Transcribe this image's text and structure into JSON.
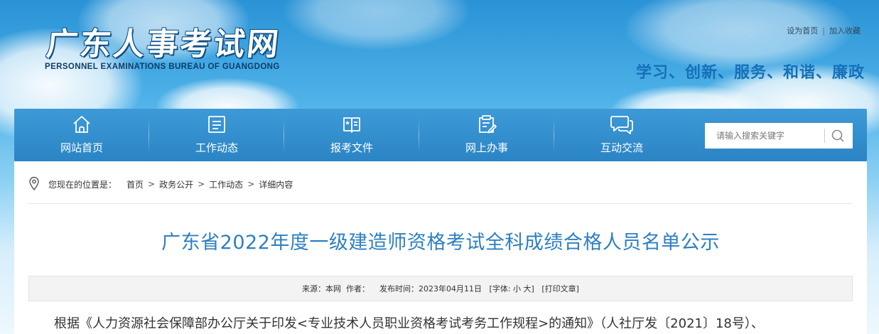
{
  "header": {
    "logo_cn": "广东人事考试网",
    "logo_en": "PERSONNEL EXAMINATIONS BUREAU OF GUANGDONG",
    "set_home": "设为首页",
    "separator": "|",
    "add_favorite": "加入收藏",
    "slogan": "学习、创新、服务、和谐、廉政"
  },
  "nav": {
    "items": [
      {
        "label": "网站首页",
        "icon": "home-icon"
      },
      {
        "label": "工作动态",
        "icon": "news-list-icon"
      },
      {
        "label": "报考文件",
        "icon": "open-book-icon"
      },
      {
        "label": "网上办事",
        "icon": "clipboard-edit-icon"
      },
      {
        "label": "互动交流",
        "icon": "chat-bubbles-icon"
      }
    ],
    "search": {
      "placeholder": "请输入搜索关键字",
      "icon": "search-icon"
    }
  },
  "breadcrumb": {
    "prefix": "您现在的位置是：",
    "items": [
      "首页",
      "政务公开",
      "工作动态",
      "详细内容"
    ],
    "arrow": ">"
  },
  "article": {
    "title": "广东省2022年度一级建造师资格考试全科成绩合格人员名单公示",
    "meta": {
      "source_label": "来源：",
      "source": "本网",
      "author_label": "作者：",
      "author": "",
      "date_label": "发布时间：",
      "date": "2023年04月11日",
      "font_label": "[字体:",
      "font_small": "小",
      "font_large": "大",
      "font_close": "]",
      "print": "[打印文章]"
    },
    "body_first_line": "根据《人力资源社会保障部办公厅关于印发<专业技术人员职业资格考试考务工作规程>的通知》（人社厅发〔2021〕18号）、"
  },
  "colors": {
    "nav_bg": "#2b84c4",
    "title": "#2e7fc1",
    "slogan": "#1670b8",
    "logo_outline": "#0d4f86"
  }
}
